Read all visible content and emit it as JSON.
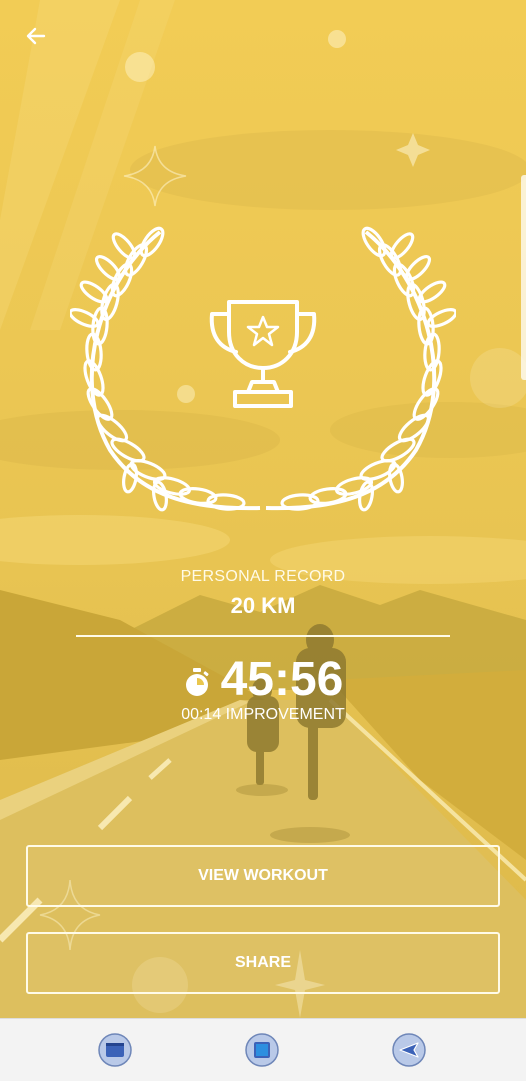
{
  "record": {
    "label": "PERSONAL RECORD",
    "distance": "20 KM",
    "time": "45:56",
    "improvement": "00:14 IMPROVEMENT"
  },
  "buttons": {
    "view_workout": "VIEW WORKOUT",
    "share": "SHARE"
  },
  "icons": {
    "back": "arrow-left-icon",
    "trophy": "trophy-icon",
    "laurel": "laurel-wreath-icon",
    "stopwatch": "stopwatch-icon",
    "recents": "recent-apps-icon",
    "home": "home-icon",
    "nav_back": "nav-back-icon"
  },
  "colors": {
    "overlay": "#e9c64e",
    "text": "#ffffff"
  }
}
